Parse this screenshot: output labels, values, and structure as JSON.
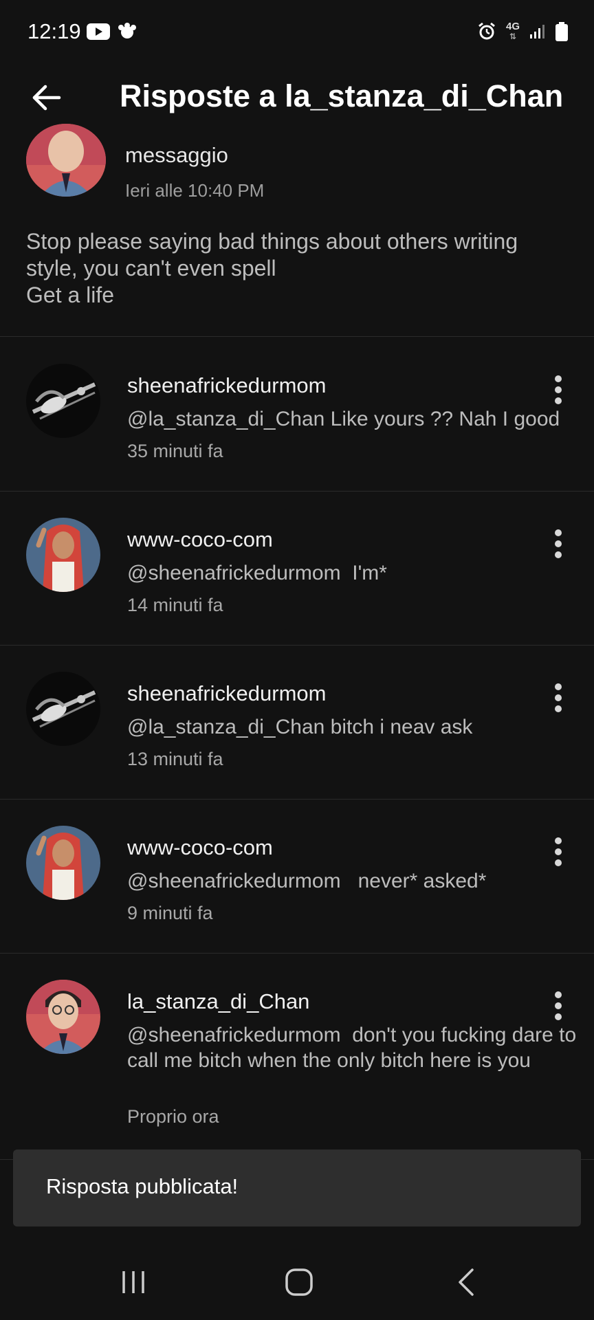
{
  "status_bar": {
    "time": "12:19",
    "left_icons": [
      "youtube-icon",
      "notification-app-icon"
    ],
    "right_icons": [
      "alarm-icon",
      "4g-icon",
      "signal-icon",
      "battery-icon"
    ],
    "network": "4G"
  },
  "header": {
    "title": "Risposte a la_stanza_di_Chan",
    "back_icon": "arrow-left-icon"
  },
  "original_comment": {
    "label": "messaggio",
    "time": "Ieri alle 10:40 PM",
    "text": "Stop please saying bad things about others writing style, you can't even spell\nGet a life"
  },
  "replies": [
    {
      "author": "sheenafrickedurmom",
      "text": "@la_stanza_di_Chan Like yours ?? Nah I good",
      "time": "35 minuti fa",
      "avatar": "guitar-avatar"
    },
    {
      "author": "www-coco-com",
      "text": "@sheenafrickedurmom  I'm*",
      "time": "14 minuti fa",
      "avatar": "redhead-avatar"
    },
    {
      "author": "sheenafrickedurmom",
      "text": "@la_stanza_di_Chan bitch i neav ask",
      "time": "13 minuti fa",
      "avatar": "guitar-avatar"
    },
    {
      "author": "www-coco-com",
      "text": "@sheenafrickedurmom   never* asked*",
      "time": "9 minuti fa",
      "avatar": "redhead-avatar"
    },
    {
      "author": "la_stanza_di_Chan",
      "text": "@sheenafrickedurmom  don't you fucking dare to call me bitch when the only bitch here is you",
      "time": "Proprio ora",
      "avatar": "boy-avatar"
    }
  ],
  "snackbar": {
    "text": "Risposta pubblicata!"
  },
  "nav_bar": {
    "buttons": [
      "recent-apps-icon",
      "home-icon",
      "back-icon"
    ]
  },
  "colors": {
    "background": "#121212",
    "divider": "#2b2b2b",
    "snackbar": "#2e2e2e",
    "secondary_text": "#bdbdbd"
  }
}
